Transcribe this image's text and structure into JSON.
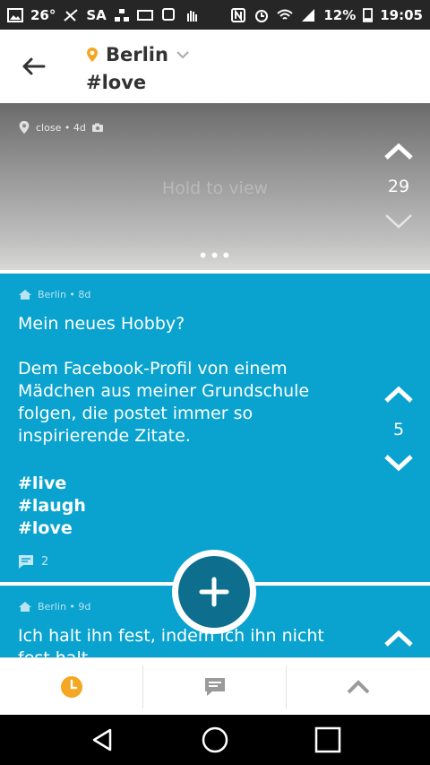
{
  "status_bar": {
    "temperature": "26°",
    "carrier": "SA",
    "battery": "12%",
    "time": "19:05"
  },
  "header": {
    "city": "Berlin",
    "hashtag": "#love"
  },
  "post1": {
    "meta": "close • 4d",
    "hold_label": "Hold to view",
    "votes": "29",
    "more": "•••"
  },
  "post2": {
    "meta": "Berlin • 8d",
    "text": "Mein neues Hobby?\n\nDem Facebook-Profil von einem Mädchen aus meiner Grundschule folgen, die postet immer so inspirierende Zitate.",
    "hashtags": [
      "#live",
      "#laugh",
      "#love"
    ],
    "votes": "5",
    "comments": "2",
    "more": "•••"
  },
  "post3": {
    "meta": "Berlin • 9d",
    "text": "Ich halt ihn fest, indem ich ihn nicht",
    "text_cut": "fest halt"
  },
  "icons": {
    "fab": "plus-icon",
    "nav": [
      "clock-icon",
      "chat-icon",
      "chevron-up-icon"
    ]
  },
  "colors": {
    "accent_orange": "#f5a623",
    "post_blue": "#0aa3cf",
    "fab_blue": "#0d6f8d"
  }
}
